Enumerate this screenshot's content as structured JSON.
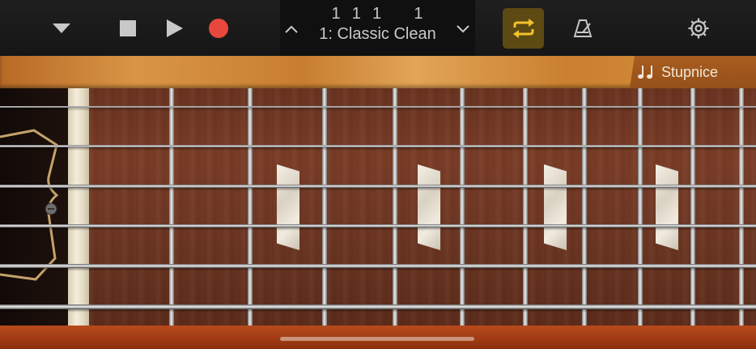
{
  "toolbar": {
    "icons": {
      "browser": "chevron-down-icon",
      "stop": "stop-icon",
      "play": "play-icon",
      "record": "record-icon",
      "cycle": "cycle-icon",
      "metronome": "metronome-icon",
      "settings": "gear-icon"
    },
    "lcd": {
      "position": "1  1  1      1",
      "patch_name": "1: Classic Clean",
      "prev_icon": "chevron-up-icon",
      "next_icon": "chevron-down-icon"
    },
    "cycle_active": true,
    "colors": {
      "record": "#e8473b",
      "cycle_active_bg": "#5c4a12",
      "cycle_icon": "#f0c22a",
      "icon": "#c8c8c8"
    }
  },
  "scales_button": {
    "icon": "music-notes-icon",
    "label": "Stupnice"
  }
}
